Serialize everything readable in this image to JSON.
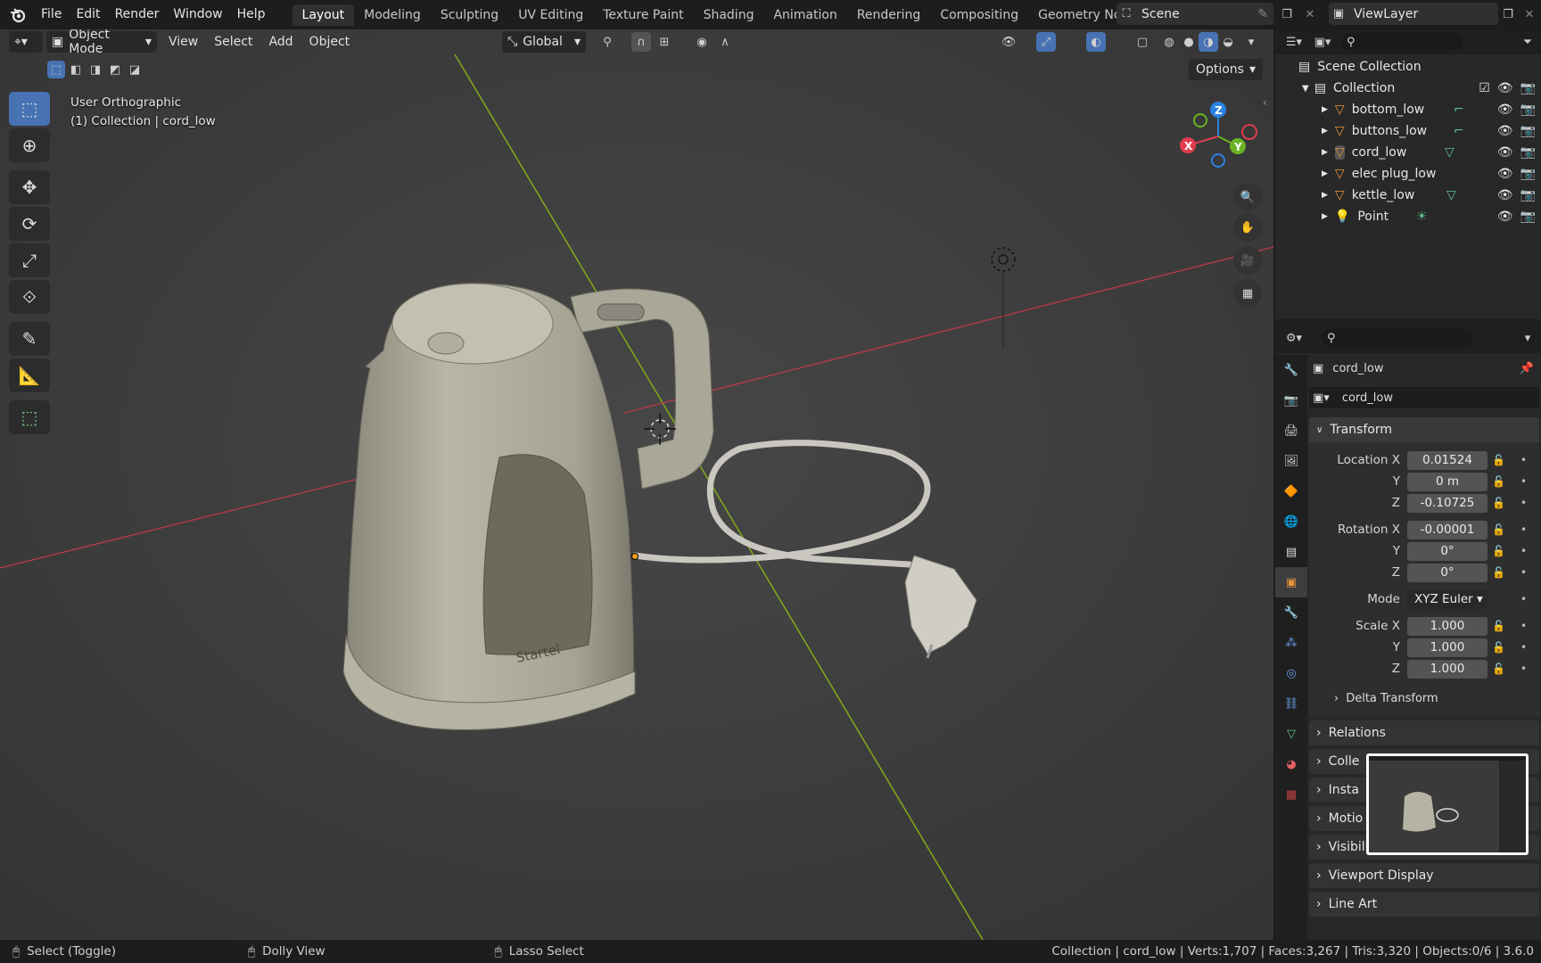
{
  "menu": [
    "File",
    "Edit",
    "Render",
    "Window",
    "Help"
  ],
  "workspaces": [
    "Layout",
    "Modeling",
    "Sculpting",
    "UV Editing",
    "Texture Paint",
    "Shading",
    "Animation",
    "Rendering",
    "Compositing",
    "Geometry Nodes"
  ],
  "scene": "Scene",
  "view_layer": "ViewLayer",
  "viewport": {
    "mode": "Object Mode",
    "menus": [
      "View",
      "Select",
      "Add",
      "Object"
    ],
    "orientation": "Global",
    "options": "Options",
    "view_name": "User Orthographic",
    "context": "(1) Collection | cord_low",
    "model_text": "Startel",
    "gizmo": {
      "x": "X",
      "y": "Y",
      "z": "Z"
    }
  },
  "outliner": {
    "root": "Scene Collection",
    "collection": "Collection",
    "items": [
      "bottom_low",
      "buttons_low",
      "cord_low",
      "elec plug_low",
      "kettle_low",
      "Point"
    ]
  },
  "properties": {
    "object_name": "cord_low",
    "data_name": "cord_low",
    "transform_label": "Transform",
    "location_x_label": "Location X",
    "location_x": "0.01524",
    "location_y": "0 m",
    "location_z": "-0.10725",
    "rotation_x_label": "Rotation X",
    "rotation_x": "-0.00001",
    "rotation_y": "0°",
    "rotation_z": "0°",
    "mode_label": "Mode",
    "mode_value": "XYZ Euler",
    "scale_x_label": "Scale X",
    "scale_x": "1.000",
    "scale_y": "1.000",
    "scale_z": "1.000",
    "y_label": "Y",
    "z_label": "Z",
    "delta_transform": "Delta Transform",
    "panels": [
      "Relations",
      "Colle",
      "Insta",
      "Motio",
      "Visibility",
      "Viewport Display",
      "Line Art"
    ]
  },
  "status": {
    "select": "Select (Toggle)",
    "dolly": "Dolly View",
    "lasso": "Lasso Select",
    "stats": "Collection | cord_low | Verts:1,707 | Faces:3,267 | Tris:3,320 | Objects:0/6 | 3.6.0"
  }
}
